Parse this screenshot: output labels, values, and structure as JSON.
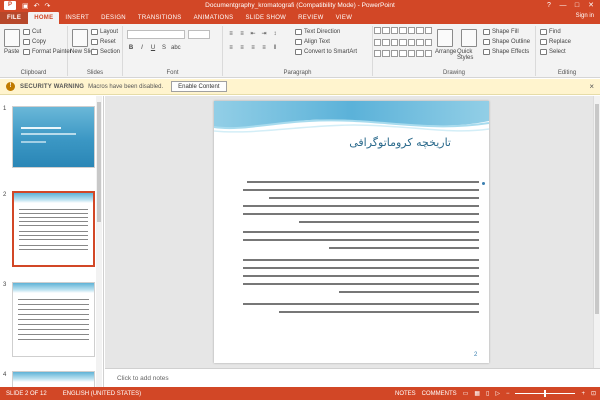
{
  "titlebar": {
    "app_icon": "P",
    "title": "Documentgraphy_kromatografi (Compatibility Mode) - PowerPoint",
    "qat": [
      "save-icon",
      "undo-icon",
      "redo-icon"
    ],
    "controls": [
      "?",
      "—",
      "□",
      "✕"
    ]
  },
  "tabs": [
    {
      "label": "FILE"
    },
    {
      "label": "HOME",
      "active": true
    },
    {
      "label": "INSERT"
    },
    {
      "label": "DESIGN"
    },
    {
      "label": "TRANSITIONS"
    },
    {
      "label": "ANIMATIONS"
    },
    {
      "label": "SLIDE SHOW"
    },
    {
      "label": "REVIEW"
    },
    {
      "label": "VIEW"
    }
  ],
  "signin": "Sign in",
  "ribbon": {
    "clipboard": {
      "label": "Clipboard",
      "paste": "Paste",
      "cut": "Cut",
      "copy": "Copy",
      "format_painter": "Format Painter"
    },
    "slides": {
      "label": "Slides",
      "new_slide": "New Slide",
      "layout": "Layout",
      "reset": "Reset",
      "section": "Section"
    },
    "font": {
      "label": "Font",
      "bold": "B",
      "italic": "I",
      "underline": "U",
      "strike": "S",
      "shadow": "abc"
    },
    "paragraph": {
      "label": "Paragraph",
      "text_direction": "Text Direction",
      "align_text": "Align Text",
      "smartart": "Convert to SmartArt"
    },
    "drawing": {
      "label": "Drawing",
      "arrange": "Arrange",
      "quick_styles": "Quick Styles",
      "shape_fill": "Shape Fill",
      "shape_outline": "Shape Outline",
      "shape_effects": "Shape Effects"
    },
    "editing": {
      "label": "Editing",
      "find": "Find",
      "replace": "Replace",
      "select": "Select"
    }
  },
  "security": {
    "title": "SECURITY WARNING",
    "message": "Macros have been disabled.",
    "button": "Enable Content"
  },
  "thumbnails": [
    {
      "number": "1"
    },
    {
      "number": "2",
      "selected": true
    },
    {
      "number": "3"
    },
    {
      "number": "4"
    }
  ],
  "slide": {
    "title": "تاریخچه کروماتوگرافی",
    "number": "2"
  },
  "notes_placeholder": "Click to add notes",
  "status": {
    "slide_info": "SLIDE 2 OF 12",
    "language": "ENGLISH (UNITED STATES)",
    "notes": "NOTES",
    "comments": "COMMENTS"
  },
  "colors": {
    "accent": "#d24726",
    "slide_title": "#2b6a8c"
  }
}
